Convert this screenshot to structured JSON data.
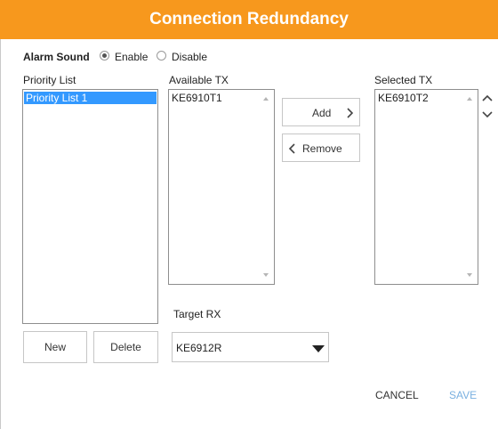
{
  "dialog": {
    "title": "Connection Redundancy"
  },
  "alarm": {
    "label": "Alarm Sound",
    "enable": "Enable",
    "disable": "Disable",
    "selected": "Enable"
  },
  "priority": {
    "label": "Priority List",
    "items": [
      "Priority List 1"
    ],
    "new_label": "New",
    "delete_label": "Delete"
  },
  "available": {
    "label": "Available TX",
    "items": [
      "KE6910T1"
    ]
  },
  "actions": {
    "add": "Add",
    "remove": "Remove"
  },
  "selected_tx": {
    "label": "Selected TX",
    "items": [
      "KE6910T2"
    ]
  },
  "target_rx": {
    "label": "Target RX",
    "value": "KE6912R"
  },
  "footer": {
    "cancel": "CANCEL",
    "save": "SAVE"
  },
  "colors": {
    "header": "#f7981d",
    "selection": "#3399ff",
    "save_disabled": "#7ab0e0"
  },
  "icons": {
    "add": "chevron-right-icon",
    "remove": "chevron-left-icon",
    "move_up": "chevron-up-icon",
    "move_down": "chevron-down-icon",
    "dropdown": "caret-down-icon"
  }
}
